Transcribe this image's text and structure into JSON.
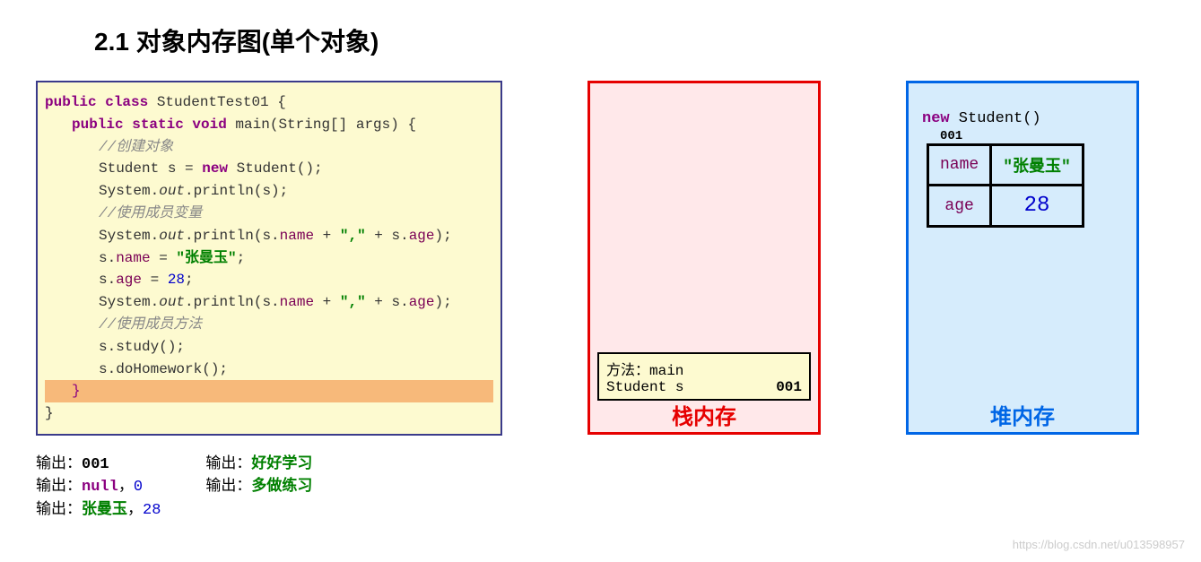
{
  "title": "2.1 对象内存图(单个对象)",
  "code": {
    "l1_kw": "public class",
    "l1_cls": " StudentTest01 {",
    "l2_kw": "public static void",
    "l2_sig": " main(String[] args) {",
    "l3_cm": "//创建对象",
    "l4_a": "Student s = ",
    "l4_kw": "new",
    "l4_b": " Student();",
    "l5_a": "System.",
    "l5_out": "out",
    "l5_b": ".println(s);",
    "l6_cm": "//使用成员变量",
    "l7_a": "System.",
    "l7_out": "out",
    "l7_b": ".println(s.",
    "l7_fld1": "name",
    "l7_c": " + ",
    "l7_str": "\",\"",
    "l7_d": " + s.",
    "l7_fld2": "age",
    "l7_e": ");",
    "l8_a": "s.",
    "l8_fld": "name",
    "l8_b": " = ",
    "l8_str": "\"张曼玉\"",
    "l8_c": ";",
    "l9_a": "s.",
    "l9_fld": "age",
    "l9_b": " = ",
    "l9_num": "28",
    "l9_c": ";",
    "l10_a": "System.",
    "l10_out": "out",
    "l10_b": ".println(s.",
    "l10_fld1": "name",
    "l10_c": " + ",
    "l10_str": "\",\"",
    "l10_d": " + s.",
    "l10_fld2": "age",
    "l10_e": ");",
    "l11_cm": "//使用成员方法",
    "l12": "s.study();",
    "l13": "s.doHomework();",
    "l14": "}",
    "l15": "}"
  },
  "stack": {
    "frame_l1": "方法：main",
    "frame_l2a": " Student s",
    "frame_l2b": "001",
    "label": "栈内存"
  },
  "heap": {
    "new_kw": "new",
    "new_rest": " Student()",
    "addr": "001",
    "row1_key": "name",
    "row1_val": "\"张曼玉\"",
    "row2_key": "age",
    "row2_val": "28",
    "label": "堆内存"
  },
  "output": {
    "col1": {
      "l1_lbl": "输出：",
      "l1_val": "001",
      "l2_lbl": "输出：",
      "l2_null": "null",
      "l2_comma": "，",
      "l2_zero": "0",
      "l3_lbl": "输出：",
      "l3_name": "张曼玉",
      "l3_comma": "，",
      "l3_age": "28"
    },
    "col2": {
      "l1_lbl": "输出：",
      "l1_val": "好好学习",
      "l2_lbl": "输出：",
      "l2_val": "多做练习"
    }
  },
  "watermark": "https://blog.csdn.net/u013598957"
}
